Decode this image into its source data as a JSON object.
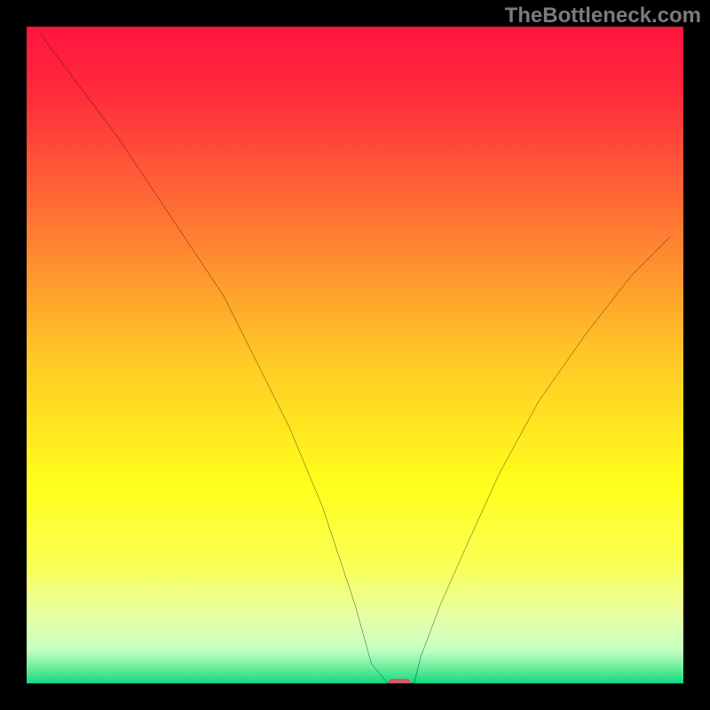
{
  "watermark": "TheBottleneck.com",
  "chart_data": {
    "type": "line",
    "title": "",
    "xlabel": "",
    "ylabel": "",
    "xlim": [
      0,
      100
    ],
    "ylim": [
      0,
      100
    ],
    "legend": false,
    "grid": false,
    "background": {
      "type": "vertical-gradient",
      "stops": [
        {
          "pos": 0.0,
          "color": "#ff153f"
        },
        {
          "pos": 0.1,
          "color": "#ff2b3c"
        },
        {
          "pos": 0.3,
          "color": "#ff7733"
        },
        {
          "pos": 0.5,
          "color": "#ffc726"
        },
        {
          "pos": 0.7,
          "color": "#ffff1b"
        },
        {
          "pos": 0.82,
          "color": "#f9ff55"
        },
        {
          "pos": 0.9,
          "color": "#e8ffa8"
        },
        {
          "pos": 0.95,
          "color": "#c2ffc2"
        },
        {
          "pos": 0.975,
          "color": "#6fef9d"
        },
        {
          "pos": 1.0,
          "color": "#11d983"
        }
      ]
    },
    "series": [
      {
        "name": "bottleneck-curve",
        "color": "#000000",
        "x": [
          2,
          8,
          14,
          20,
          26,
          30,
          35,
          40,
          45,
          50,
          52.5,
          55,
          57,
          59,
          60,
          63,
          67,
          72,
          78,
          85,
          92,
          98
        ],
        "y": [
          99,
          91,
          83,
          74,
          65,
          59,
          49,
          39,
          27,
          12,
          3,
          0,
          0,
          0,
          4,
          12,
          21,
          32,
          43,
          53,
          62,
          68
        ]
      }
    ],
    "marker": {
      "name": "minimum-marker",
      "x_range": [
        55,
        58.5
      ],
      "y": 0,
      "color": "#d15a5f",
      "shape": "pill"
    }
  }
}
